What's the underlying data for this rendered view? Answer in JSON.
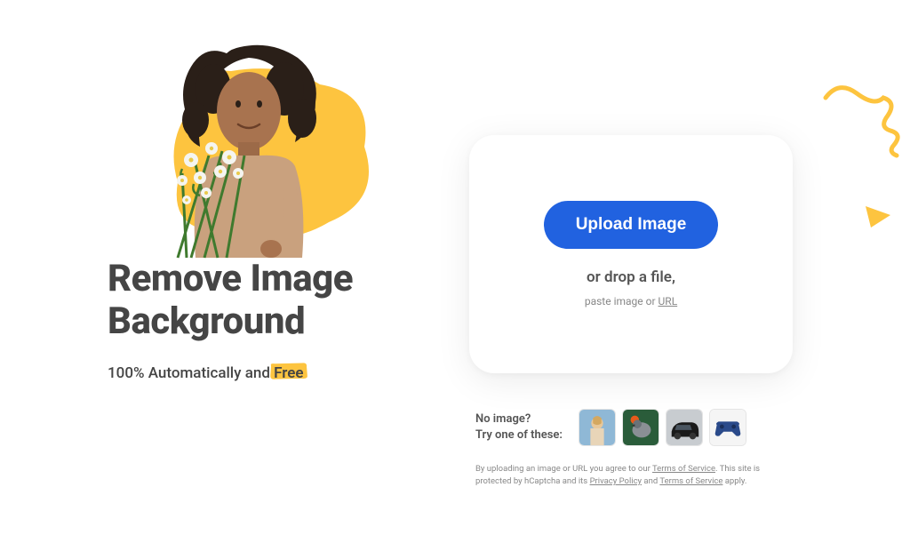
{
  "hero": {
    "headline_line1": "Remove Image",
    "headline_line2": "Background",
    "subhead_prefix": "100% Automatically and ",
    "subhead_badge": "Free"
  },
  "upload": {
    "button_label": "Upload Image",
    "drop_text": "or drop a file,",
    "paste_text_prefix": "paste image or ",
    "paste_url_label": "URL"
  },
  "samples": {
    "prompt_line1": "No image?",
    "prompt_line2": "Try one of these:",
    "items": [
      {
        "name": "person"
      },
      {
        "name": "bird"
      },
      {
        "name": "car"
      },
      {
        "name": "controller"
      }
    ]
  },
  "legal": {
    "text1": "By uploading an image or URL you agree to our ",
    "tos_label": "Terms of Service",
    "text2": ". This site is protected by hCaptcha and its ",
    "privacy_label": "Privacy Policy",
    "text3": " and ",
    "tos2_label": "Terms of Service",
    "text4": " apply."
  },
  "colors": {
    "accent_yellow": "#fdc43f",
    "button_blue": "#2162e0"
  }
}
